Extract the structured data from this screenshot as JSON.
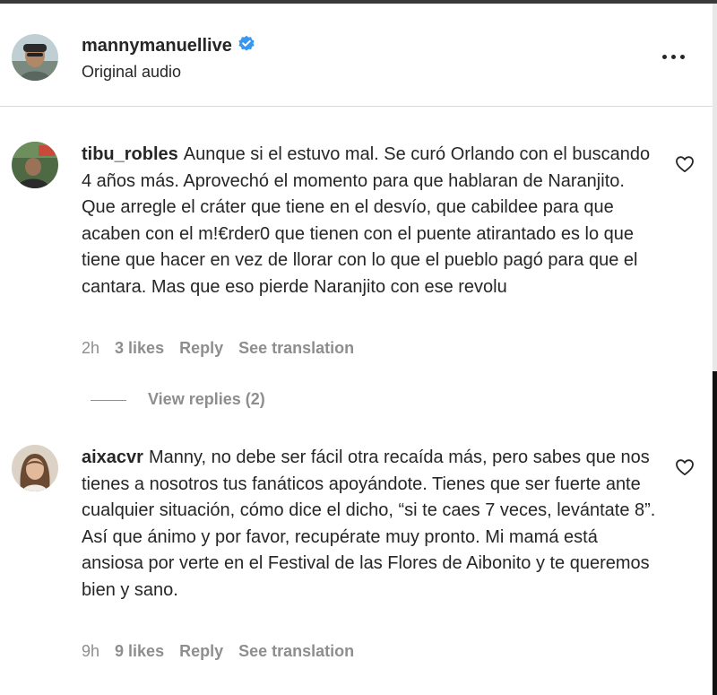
{
  "header": {
    "username": "mannymanuellive",
    "subtitle": "Original audio",
    "verified": true
  },
  "comments": [
    {
      "username": "tibu_robles",
      "text": "Aunque si el estuvo mal. Se curó Orlando con el buscando 4 años más. Aprovechó el momento para que hablaran de Naranjito. Que arregle el cráter que tiene en el desvío, que cabildee para que acaben con el m!€rder0 que tienen con el puente atirantado es lo que tiene que hacer en vez de llorar con lo que el pueblo pagó para que el cantara. Mas que eso pierde Naranjito con ese revolu",
      "time": "2h",
      "likes": "3 likes",
      "reply_label": "Reply",
      "translate_label": "See translation",
      "view_replies": "View replies (2)"
    },
    {
      "username": "aixacvr",
      "text": "Manny, no debe ser fácil otra recaída más, pero sabes que nos tienes a nosotros tus fanáticos apoyándote. Tienes que ser fuerte ante cualquier situación, cómo dice el dicho, “si te caes 7 veces, levántate 8”. Así que ánimo y por favor, recupérate muy pronto. Mi mamá está ansiosa por verte en el Festival de las Flores de Aibonito y te queremos bien y sano.",
      "time": "9h",
      "likes": "9 likes",
      "reply_label": "Reply",
      "translate_label": "See translation"
    }
  ],
  "icons": {
    "verified": "verified-badge-icon",
    "more": "more-options-icon",
    "like": "heart-outline-icon"
  },
  "colors": {
    "text": "#262626",
    "secondary": "#8e8e8e",
    "verified": "#3897f0",
    "divider": "#dbdbdb"
  }
}
